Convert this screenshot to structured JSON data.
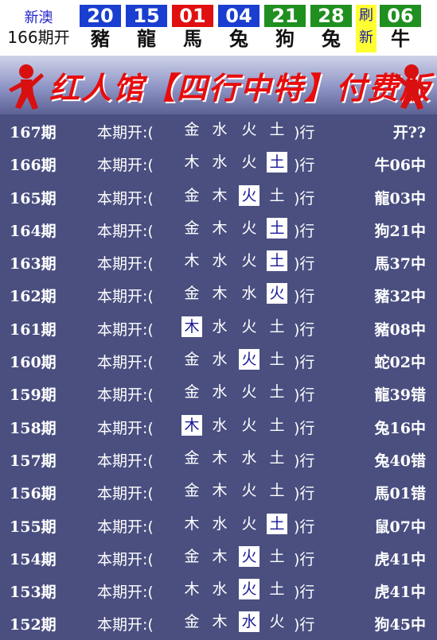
{
  "header": {
    "region": "新澳",
    "issue": "166期开",
    "balls": [
      {
        "num": "20",
        "zodiac": "豬",
        "color": "#1a3ecf"
      },
      {
        "num": "15",
        "zodiac": "龍",
        "color": "#1a3ecf"
      },
      {
        "num": "01",
        "zodiac": "馬",
        "color": "#e01010"
      },
      {
        "num": "04",
        "zodiac": "兔",
        "color": "#1a3ecf"
      },
      {
        "num": "21",
        "zodiac": "狗",
        "color": "#1f8f1f"
      },
      {
        "num": "28",
        "zodiac": "兔",
        "color": "#1f8f1f"
      }
    ],
    "refresh_top": "刷",
    "refresh_bottom": "新",
    "special": {
      "num": "06",
      "zodiac": "牛",
      "color": "#1f8f1f"
    }
  },
  "banner": {
    "title": "红人馆【四行中特】付费版"
  },
  "label_prefix": "本期开:(",
  "label_suffix": ")行",
  "rows": [
    {
      "period": "167期",
      "elements": [
        "金",
        "水",
        "火",
        "土"
      ],
      "hl": -1,
      "result": "开??"
    },
    {
      "period": "166期",
      "elements": [
        "木",
        "水",
        "火",
        "土"
      ],
      "hl": 3,
      "result": "牛06中"
    },
    {
      "period": "165期",
      "elements": [
        "金",
        "木",
        "火",
        "土"
      ],
      "hl": 2,
      "result": "龍03中"
    },
    {
      "period": "164期",
      "elements": [
        "金",
        "木",
        "火",
        "土"
      ],
      "hl": 3,
      "result": "狗21中"
    },
    {
      "period": "163期",
      "elements": [
        "木",
        "水",
        "火",
        "土"
      ],
      "hl": 3,
      "result": "馬37中"
    },
    {
      "period": "162期",
      "elements": [
        "金",
        "木",
        "水",
        "火"
      ],
      "hl": 3,
      "result": "豬32中"
    },
    {
      "period": "161期",
      "elements": [
        "木",
        "水",
        "火",
        "土"
      ],
      "hl": 0,
      "result": "豬08中"
    },
    {
      "period": "160期",
      "elements": [
        "金",
        "水",
        "火",
        "土"
      ],
      "hl": 2,
      "result": "蛇02中"
    },
    {
      "period": "159期",
      "elements": [
        "金",
        "水",
        "火",
        "土"
      ],
      "hl": -1,
      "result": "龍39错"
    },
    {
      "period": "158期",
      "elements": [
        "木",
        "水",
        "火",
        "土"
      ],
      "hl": 0,
      "result": "兔16中"
    },
    {
      "period": "157期",
      "elements": [
        "金",
        "木",
        "水",
        "土"
      ],
      "hl": -1,
      "result": "兔40错"
    },
    {
      "period": "156期",
      "elements": [
        "金",
        "木",
        "火",
        "土"
      ],
      "hl": -1,
      "result": "馬01错"
    },
    {
      "period": "155期",
      "elements": [
        "木",
        "水",
        "火",
        "土"
      ],
      "hl": 3,
      "result": "鼠07中"
    },
    {
      "period": "154期",
      "elements": [
        "金",
        "木",
        "火",
        "土"
      ],
      "hl": 2,
      "result": "虎41中"
    },
    {
      "period": "153期",
      "elements": [
        "木",
        "水",
        "火",
        "土"
      ],
      "hl": 2,
      "result": "虎41中"
    },
    {
      "period": "152期",
      "elements": [
        "金",
        "木",
        "水",
        "火"
      ],
      "hl": 2,
      "result": "狗45中"
    }
  ]
}
